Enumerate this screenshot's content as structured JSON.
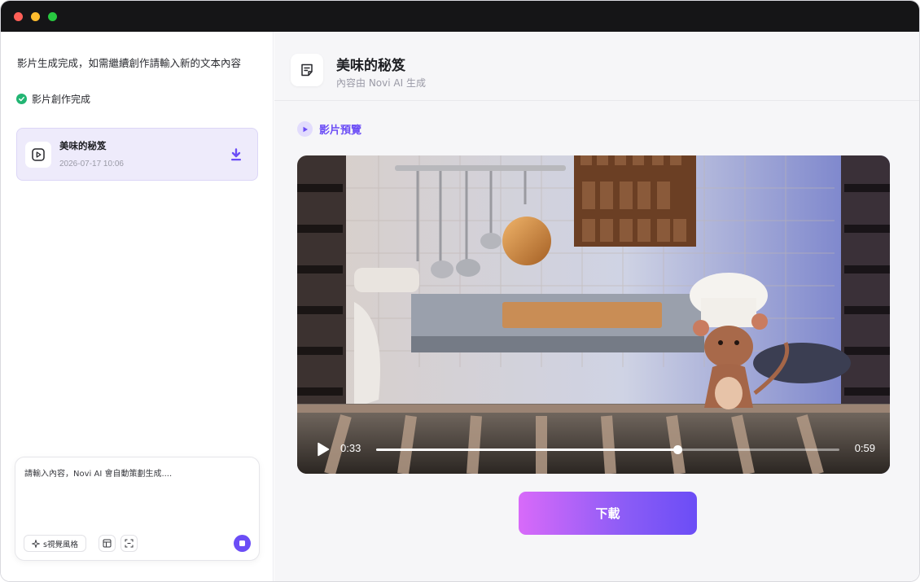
{
  "sidebar": {
    "hint": "影片生成完成，如需繼續創作請輸入新的文本內容",
    "status_text": "影片創作完成",
    "card": {
      "title": "美味的秘笈",
      "date": "2026-07-17 10:06"
    },
    "composer": {
      "placeholder": "請輸入內容，Novi AI 會自動策劃生成....",
      "style_label": "s視覺風格"
    }
  },
  "main": {
    "title": "美味的秘笈",
    "subtitle": "內容由 Novi AI 生成",
    "section_label": "影片預覽",
    "video": {
      "current_time": "0:33",
      "duration": "0:59",
      "progress": 0.65
    },
    "download_label": "下載"
  },
  "colors": {
    "accent": "#6b4df6",
    "success": "#22b573",
    "button_gradient_start": "#d86af9"
  }
}
